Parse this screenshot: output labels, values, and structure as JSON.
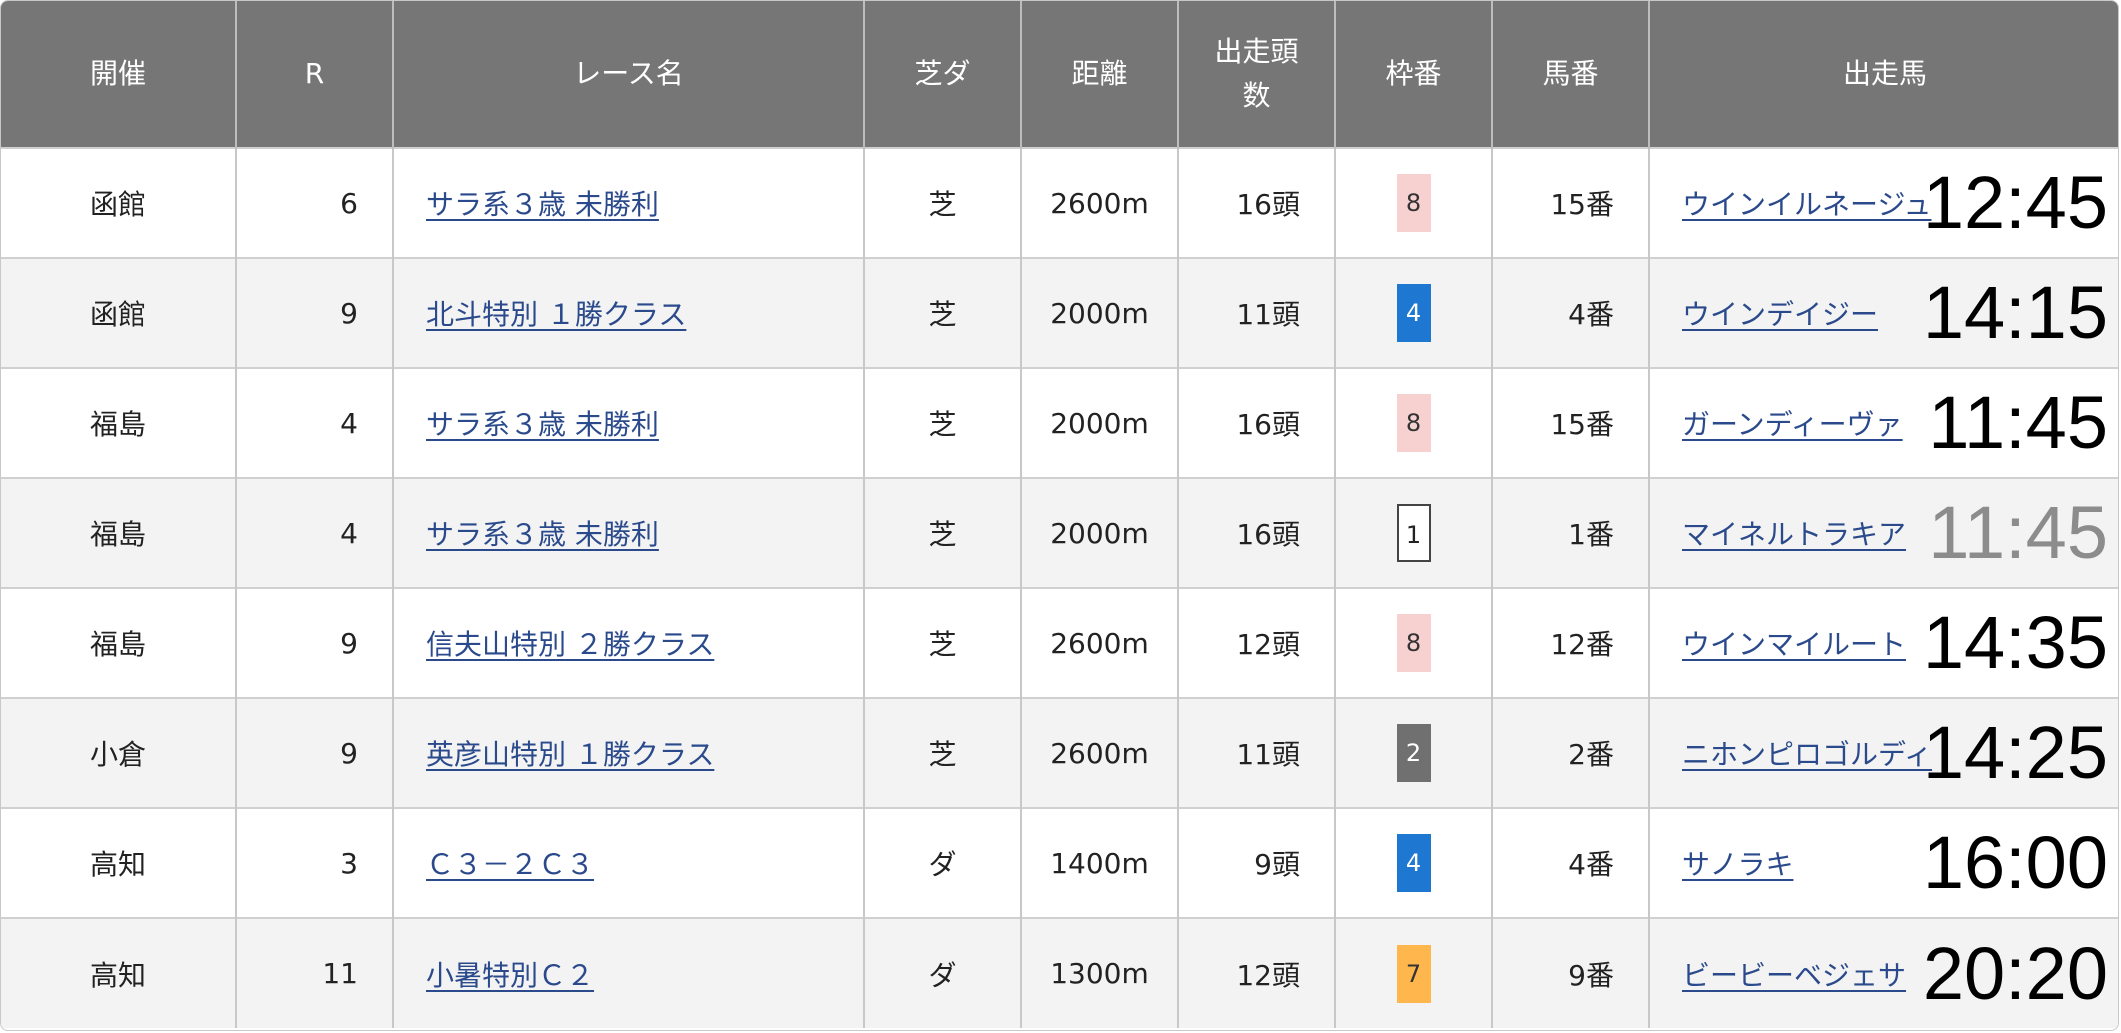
{
  "headers": {
    "venue": "開催",
    "race_no": "R",
    "race_name": "レース名",
    "surface": "芝ダ",
    "distance": "距離",
    "runners_line1": "出走頭",
    "runners_line2": "数",
    "frame": "枠番",
    "horse_no": "馬番",
    "horse": "出走馬"
  },
  "rows": [
    {
      "venue": "函館",
      "race_no": "6",
      "race_name": "サラ系３歳 未勝利",
      "surface": "芝",
      "distance": "2600m",
      "runners": "16頭",
      "frame": "8",
      "frame_bg": "#f7d0d0",
      "frame_fg": "#333333",
      "frame_border": "none",
      "horse_no": "15番",
      "horse": "ウインイルネージュ",
      "post_time": "12:45",
      "time_color": "#000000"
    },
    {
      "venue": "函館",
      "race_no": "9",
      "race_name": "北斗特別 １勝クラス",
      "surface": "芝",
      "distance": "2000m",
      "runners": "11頭",
      "frame": "4",
      "frame_bg": "#1e78d2",
      "frame_fg": "#ffffff",
      "frame_border": "none",
      "horse_no": "4番",
      "horse": "ウインデイジー",
      "post_time": "14:15",
      "time_color": "#000000"
    },
    {
      "venue": "福島",
      "race_no": "4",
      "race_name": "サラ系３歳 未勝利",
      "surface": "芝",
      "distance": "2000m",
      "runners": "16頭",
      "frame": "8",
      "frame_bg": "#f7d0d0",
      "frame_fg": "#333333",
      "frame_border": "none",
      "horse_no": "15番",
      "horse": "ガーンディーヴァ",
      "post_time": "11:45",
      "time_color": "#000000"
    },
    {
      "venue": "福島",
      "race_no": "4",
      "race_name": "サラ系３歳 未勝利",
      "surface": "芝",
      "distance": "2000m",
      "runners": "16頭",
      "frame": "1",
      "frame_bg": "#ffffff",
      "frame_fg": "#222222",
      "frame_border": "2px solid #444444",
      "horse_no": "1番",
      "horse": "マイネルトラキア",
      "post_time": "11:45",
      "time_color": "#8c8c8c"
    },
    {
      "venue": "福島",
      "race_no": "9",
      "race_name": "信夫山特別 ２勝クラス",
      "surface": "芝",
      "distance": "2600m",
      "runners": "12頭",
      "frame": "8",
      "frame_bg": "#f7d0d0",
      "frame_fg": "#333333",
      "frame_border": "none",
      "horse_no": "12番",
      "horse": "ウインマイルート",
      "post_time": "14:35",
      "time_color": "#000000"
    },
    {
      "venue": "小倉",
      "race_no": "9",
      "race_name": "英彦山特別 １勝クラス",
      "surface": "芝",
      "distance": "2600m",
      "runners": "11頭",
      "frame": "2",
      "frame_bg": "#707070",
      "frame_fg": "#ffffff",
      "frame_border": "none",
      "horse_no": "2番",
      "horse": "ニホンピロゴルディ",
      "post_time": "14:25",
      "time_color": "#000000"
    },
    {
      "venue": "高知",
      "race_no": "3",
      "race_name": "Ｃ３－２Ｃ３",
      "surface": "ダ",
      "distance": "1400m",
      "runners": "9頭",
      "frame": "4",
      "frame_bg": "#1e78d2",
      "frame_fg": "#ffffff",
      "frame_border": "none",
      "horse_no": "4番",
      "horse": "サノラキ",
      "post_time": "16:00",
      "time_color": "#000000"
    },
    {
      "venue": "高知",
      "race_no": "11",
      "race_name": "小暑特別Ｃ２",
      "surface": "ダ",
      "distance": "1300m",
      "runners": "12頭",
      "frame": "7",
      "frame_bg": "#ffb64d",
      "frame_fg": "#333333",
      "frame_border": "none",
      "horse_no": "9番",
      "horse": "ビービーベジェサ",
      "post_time": "20:20",
      "time_color": "#000000"
    }
  ]
}
